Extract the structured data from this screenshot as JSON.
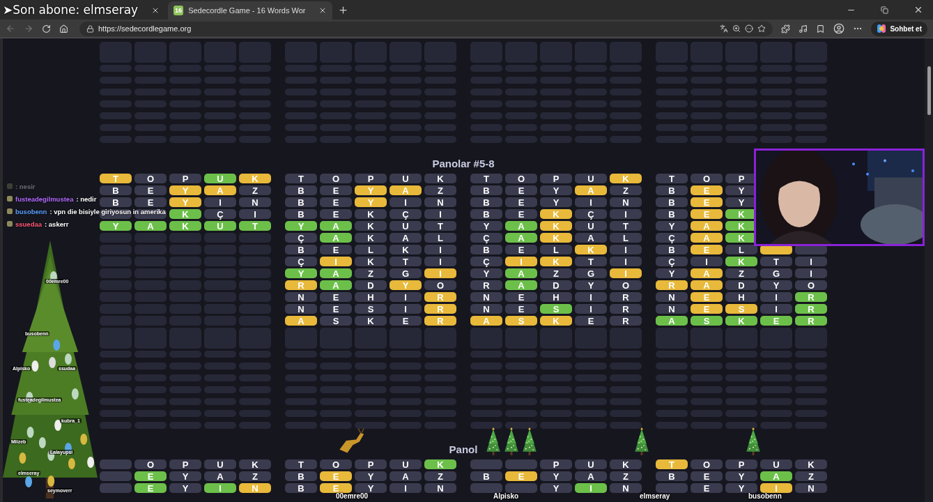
{
  "banner": "➤Son abone: elmseray",
  "tabs": [
    {
      "selected": false
    },
    {
      "icon": "16",
      "title": "Sedecordle Game - 16 Words Wor",
      "selected": true
    }
  ],
  "address": "https://sedecordlegame.org",
  "chat_button": "Sohbet et",
  "sections": [
    {
      "kind": "tail"
    },
    {
      "kind": "full",
      "heading": "Panolar #5-8",
      "boards": [
        {
          "rows": [
            {
              "tiles": [
                {
                  "letter": "T",
                  "color": "#e8b93a"
                },
                {
                  "letter": "O",
                  "color": "#3a3b4e"
                },
                {
                  "letter": "P",
                  "color": "#3a3b4e"
                },
                {
                  "letter": "U",
                  "color": "#6cc04a"
                },
                {
                  "letter": "K",
                  "color": "#e8b93a"
                }
              ]
            },
            {
              "tiles": [
                {
                  "letter": "B",
                  "color": "#3a3b4e"
                },
                {
                  "letter": "E",
                  "color": "#3a3b4e"
                },
                {
                  "letter": "Y",
                  "color": "#e8b93a"
                },
                {
                  "letter": "A",
                  "color": "#e8b93a"
                },
                {
                  "letter": "Z",
                  "color": "#3a3b4e"
                }
              ]
            },
            {
              "tiles": [
                {
                  "letter": "B",
                  "color": "#3a3b4e"
                },
                {
                  "letter": "E",
                  "color": "#3a3b4e"
                },
                {
                  "letter": "Y",
                  "color": "#e8b93a"
                },
                {
                  "letter": "I",
                  "color": "#3a3b4e"
                },
                {
                  "letter": "N",
                  "color": "#3a3b4e"
                }
              ]
            },
            {
              "tiles": [
                {
                  "color": "#3a3b4e"
                },
                {
                  "color": "#3a3b4e"
                },
                {
                  "letter": "K",
                  "color": "#6cc04a"
                },
                {
                  "letter": "Ç",
                  "color": "#3a3b4e"
                },
                {
                  "letter": "I",
                  "color": "#3a3b4e"
                }
              ]
            },
            {
              "tiles": [
                {
                  "letter": "Y",
                  "color": "#6cc04a"
                },
                {
                  "letter": "A",
                  "color": "#6cc04a"
                },
                {
                  "letter": "K",
                  "color": "#6cc04a"
                },
                {
                  "letter": "U",
                  "color": "#6cc04a"
                },
                {
                  "letter": "T",
                  "color": "#6cc04a"
                }
              ]
            }
          ]
        },
        {
          "rows": [
            {
              "tiles": [
                {
                  "letter": "T",
                  "color": "#3a3b4e"
                },
                {
                  "letter": "O",
                  "color": "#3a3b4e"
                },
                {
                  "letter": "P",
                  "color": "#3a3b4e"
                },
                {
                  "letter": "U",
                  "color": "#3a3b4e"
                },
                {
                  "letter": "K",
                  "color": "#3a3b4e"
                }
              ]
            },
            {
              "tiles": [
                {
                  "letter": "B",
                  "color": "#3a3b4e"
                },
                {
                  "letter": "E",
                  "color": "#3a3b4e"
                },
                {
                  "letter": "Y",
                  "color": "#e8b93a"
                },
                {
                  "letter": "A",
                  "color": "#e8b93a"
                },
                {
                  "letter": "Z",
                  "color": "#3a3b4e"
                }
              ]
            },
            {
              "tiles": [
                {
                  "letter": "B",
                  "color": "#3a3b4e"
                },
                {
                  "letter": "E",
                  "color": "#3a3b4e"
                },
                {
                  "letter": "Y",
                  "color": "#e8b93a"
                },
                {
                  "letter": "I",
                  "color": "#3a3b4e"
                },
                {
                  "letter": "N",
                  "color": "#3a3b4e"
                }
              ]
            },
            {
              "tiles": [
                {
                  "letter": "B",
                  "color": "#3a3b4e"
                },
                {
                  "letter": "E",
                  "color": "#3a3b4e"
                },
                {
                  "letter": "K",
                  "color": "#3a3b4e"
                },
                {
                  "letter": "Ç",
                  "color": "#3a3b4e"
                },
                {
                  "letter": "I",
                  "color": "#3a3b4e"
                }
              ]
            },
            {
              "tiles": [
                {
                  "letter": "Y",
                  "color": "#6cc04a"
                },
                {
                  "letter": "A",
                  "color": "#6cc04a"
                },
                {
                  "letter": "K",
                  "color": "#3a3b4e"
                },
                {
                  "letter": "U",
                  "color": "#3a3b4e"
                },
                {
                  "letter": "T",
                  "color": "#3a3b4e"
                }
              ]
            },
            {
              "tiles": [
                {
                  "letter": "Ç",
                  "color": "#3a3b4e"
                },
                {
                  "letter": "A",
                  "color": "#6cc04a"
                },
                {
                  "letter": "K",
                  "color": "#3a3b4e"
                },
                {
                  "letter": "A",
                  "color": "#3a3b4e"
                },
                {
                  "letter": "L",
                  "color": "#3a3b4e"
                }
              ]
            },
            {
              "tiles": [
                {
                  "letter": "B",
                  "color": "#3a3b4e"
                },
                {
                  "letter": "E",
                  "color": "#3a3b4e"
                },
                {
                  "letter": "L",
                  "color": "#3a3b4e"
                },
                {
                  "letter": "K",
                  "color": "#3a3b4e"
                },
                {
                  "letter": "I",
                  "color": "#3a3b4e"
                }
              ]
            },
            {
              "tiles": [
                {
                  "letter": "Ç",
                  "color": "#3a3b4e"
                },
                {
                  "letter": "I",
                  "color": "#e8b93a"
                },
                {
                  "letter": "K",
                  "color": "#3a3b4e"
                },
                {
                  "letter": "T",
                  "color": "#3a3b4e"
                },
                {
                  "letter": "I",
                  "color": "#3a3b4e"
                }
              ]
            },
            {
              "tiles": [
                {
                  "letter": "Y",
                  "color": "#6cc04a"
                },
                {
                  "letter": "A",
                  "color": "#6cc04a"
                },
                {
                  "letter": "Z",
                  "color": "#3a3b4e"
                },
                {
                  "letter": "G",
                  "color": "#3a3b4e"
                },
                {
                  "letter": "I",
                  "color": "#e8b93a"
                }
              ]
            },
            {
              "tiles": [
                {
                  "letter": "R",
                  "color": "#e8b93a"
                },
                {
                  "letter": "A",
                  "color": "#6cc04a"
                },
                {
                  "letter": "D",
                  "color": "#3a3b4e"
                },
                {
                  "letter": "Y",
                  "color": "#e8b93a"
                },
                {
                  "letter": "O",
                  "color": "#3a3b4e"
                }
              ]
            },
            {
              "tiles": [
                {
                  "letter": "N",
                  "color": "#3a3b4e"
                },
                {
                  "letter": "E",
                  "color": "#3a3b4e"
                },
                {
                  "letter": "H",
                  "color": "#3a3b4e"
                },
                {
                  "letter": "I",
                  "color": "#3a3b4e"
                },
                {
                  "letter": "R",
                  "color": "#e8b93a"
                }
              ]
            },
            {
              "tiles": [
                {
                  "letter": "N",
                  "color": "#3a3b4e"
                },
                {
                  "letter": "E",
                  "color": "#3a3b4e"
                },
                {
                  "letter": "S",
                  "color": "#3a3b4e"
                },
                {
                  "letter": "I",
                  "color": "#3a3b4e"
                },
                {
                  "letter": "R",
                  "color": "#e8b93a"
                }
              ]
            },
            {
              "tiles": [
                {
                  "letter": "A",
                  "color": "#e8b93a"
                },
                {
                  "letter": "S",
                  "color": "#3a3b4e"
                },
                {
                  "letter": "K",
                  "color": "#3a3b4e"
                },
                {
                  "letter": "E",
                  "color": "#3a3b4e"
                },
                {
                  "letter": "R",
                  "color": "#e8b93a"
                }
              ]
            }
          ]
        },
        {
          "rows": [
            {
              "tiles": [
                {
                  "letter": "T",
                  "color": "#3a3b4e"
                },
                {
                  "letter": "O",
                  "color": "#3a3b4e"
                },
                {
                  "letter": "P",
                  "color": "#3a3b4e"
                },
                {
                  "letter": "U",
                  "color": "#3a3b4e"
                },
                {
                  "letter": "K",
                  "color": "#e8b93a"
                }
              ]
            },
            {
              "tiles": [
                {
                  "letter": "B",
                  "color": "#3a3b4e"
                },
                {
                  "letter": "E",
                  "color": "#3a3b4e"
                },
                {
                  "letter": "Y",
                  "color": "#3a3b4e"
                },
                {
                  "letter": "A",
                  "color": "#e8b93a"
                },
                {
                  "letter": "Z",
                  "color": "#3a3b4e"
                }
              ]
            },
            {
              "tiles": [
                {
                  "letter": "B",
                  "color": "#3a3b4e"
                },
                {
                  "letter": "E",
                  "color": "#3a3b4e"
                },
                {
                  "letter": "Y",
                  "color": "#3a3b4e"
                },
                {
                  "letter": "I",
                  "color": "#3a3b4e"
                },
                {
                  "letter": "N",
                  "color": "#3a3b4e"
                }
              ]
            },
            {
              "tiles": [
                {
                  "letter": "B",
                  "color": "#3a3b4e"
                },
                {
                  "letter": "E",
                  "color": "#3a3b4e"
                },
                {
                  "letter": "K",
                  "color": "#e8b93a"
                },
                {
                  "letter": "Ç",
                  "color": "#3a3b4e"
                },
                {
                  "letter": "I",
                  "color": "#3a3b4e"
                }
              ]
            },
            {
              "tiles": [
                {
                  "letter": "Y",
                  "color": "#3a3b4e"
                },
                {
                  "letter": "A",
                  "color": "#6cc04a"
                },
                {
                  "letter": "K",
                  "color": "#e8b93a"
                },
                {
                  "letter": "U",
                  "color": "#3a3b4e"
                },
                {
                  "letter": "T",
                  "color": "#3a3b4e"
                }
              ]
            },
            {
              "tiles": [
                {
                  "letter": "Ç",
                  "color": "#3a3b4e"
                },
                {
                  "letter": "A",
                  "color": "#6cc04a"
                },
                {
                  "letter": "K",
                  "color": "#e8b93a"
                },
                {
                  "letter": "A",
                  "color": "#3a3b4e"
                },
                {
                  "letter": "L",
                  "color": "#3a3b4e"
                }
              ]
            },
            {
              "tiles": [
                {
                  "letter": "B",
                  "color": "#3a3b4e"
                },
                {
                  "letter": "E",
                  "color": "#3a3b4e"
                },
                {
                  "letter": "L",
                  "color": "#3a3b4e"
                },
                {
                  "letter": "K",
                  "color": "#e8b93a"
                },
                {
                  "letter": "I",
                  "color": "#3a3b4e"
                }
              ]
            },
            {
              "tiles": [
                {
                  "letter": "Ç",
                  "color": "#3a3b4e"
                },
                {
                  "letter": "I",
                  "color": "#e8b93a"
                },
                {
                  "letter": "K",
                  "color": "#e8b93a"
                },
                {
                  "letter": "T",
                  "color": "#3a3b4e"
                },
                {
                  "letter": "I",
                  "color": "#3a3b4e"
                }
              ]
            },
            {
              "tiles": [
                {
                  "letter": "Y",
                  "color": "#3a3b4e"
                },
                {
                  "letter": "A",
                  "color": "#6cc04a"
                },
                {
                  "letter": "Z",
                  "color": "#3a3b4e"
                },
                {
                  "letter": "G",
                  "color": "#3a3b4e"
                },
                {
                  "letter": "I",
                  "color": "#e8b93a"
                }
              ]
            },
            {
              "tiles": [
                {
                  "letter": "R",
                  "color": "#3a3b4e"
                },
                {
                  "letter": "A",
                  "color": "#6cc04a"
                },
                {
                  "letter": "D",
                  "color": "#3a3b4e"
                },
                {
                  "letter": "Y",
                  "color": "#3a3b4e"
                },
                {
                  "letter": "O",
                  "color": "#3a3b4e"
                }
              ]
            },
            {
              "tiles": [
                {
                  "letter": "N",
                  "color": "#3a3b4e"
                },
                {
                  "letter": "E",
                  "color": "#3a3b4e"
                },
                {
                  "letter": "H",
                  "color": "#3a3b4e"
                },
                {
                  "letter": "I",
                  "color": "#3a3b4e"
                },
                {
                  "letter": "R",
                  "color": "#3a3b4e"
                }
              ]
            },
            {
              "tiles": [
                {
                  "letter": "N",
                  "color": "#3a3b4e"
                },
                {
                  "letter": "E",
                  "color": "#3a3b4e"
                },
                {
                  "letter": "S",
                  "color": "#6cc04a"
                },
                {
                  "letter": "I",
                  "color": "#3a3b4e"
                },
                {
                  "letter": "R",
                  "color": "#3a3b4e"
                }
              ]
            },
            {
              "tiles": [
                {
                  "letter": "A",
                  "color": "#e8b93a"
                },
                {
                  "letter": "S",
                  "color": "#e8b93a"
                },
                {
                  "letter": "K",
                  "color": "#e8b93a"
                },
                {
                  "letter": "E",
                  "color": "#3a3b4e"
                },
                {
                  "letter": "R",
                  "color": "#3a3b4e"
                }
              ]
            }
          ]
        },
        {
          "rows": [
            {
              "tiles": [
                {
                  "letter": "T",
                  "color": "#3a3b4e"
                },
                {
                  "letter": "O",
                  "color": "#3a3b4e"
                },
                {
                  "letter": "P",
                  "color": "#3a3b4e"
                }
              ]
            },
            {
              "tiles": [
                {
                  "letter": "B",
                  "color": "#3a3b4e"
                },
                {
                  "letter": "E",
                  "color": "#e8b93a"
                },
                {
                  "letter": "Y",
                  "color": "#3a3b4e"
                }
              ]
            },
            {
              "tiles": [
                {
                  "letter": "B",
                  "color": "#3a3b4e"
                },
                {
                  "letter": "E",
                  "color": "#e8b93a"
                },
                {
                  "letter": "Y",
                  "color": "#3a3b4e"
                }
              ]
            },
            {
              "tiles": [
                {
                  "letter": "B",
                  "color": "#3a3b4e"
                },
                {
                  "letter": "E",
                  "color": "#e8b93a"
                },
                {
                  "letter": "K",
                  "color": "#6cc04a"
                }
              ]
            },
            {
              "tiles": [
                {
                  "letter": "Y",
                  "color": "#3a3b4e"
                },
                {
                  "letter": "A",
                  "color": "#e8b93a"
                },
                {
                  "letter": "K",
                  "color": "#6cc04a"
                }
              ]
            },
            {
              "tiles": [
                {
                  "letter": "Ç",
                  "color": "#3a3b4e"
                },
                {
                  "letter": "A",
                  "color": "#e8b93a"
                },
                {
                  "letter": "K",
                  "color": "#6cc04a"
                }
              ]
            },
            {
              "tiles": [
                {
                  "letter": "B",
                  "color": "#3a3b4e"
                },
                {
                  "letter": "E",
                  "color": "#e8b93a"
                },
                {
                  "letter": "L",
                  "color": "#3a3b4e"
                },
                {
                  "color": "#e8b93a"
                },
                {
                  "color": "#3a3b4e"
                }
              ]
            },
            {
              "tiles": [
                {
                  "letter": "Ç",
                  "color": "#3a3b4e"
                },
                {
                  "letter": "I",
                  "color": "#3a3b4e"
                },
                {
                  "letter": "K",
                  "color": "#6cc04a"
                },
                {
                  "letter": "T",
                  "color": "#3a3b4e"
                },
                {
                  "letter": "I",
                  "color": "#3a3b4e"
                }
              ]
            },
            {
              "tiles": [
                {
                  "letter": "Y",
                  "color": "#3a3b4e"
                },
                {
                  "letter": "A",
                  "color": "#e8b93a"
                },
                {
                  "letter": "Z",
                  "color": "#3a3b4e"
                },
                {
                  "letter": "G",
                  "color": "#3a3b4e"
                },
                {
                  "letter": "I",
                  "color": "#3a3b4e"
                }
              ]
            },
            {
              "tiles": [
                {
                  "letter": "R",
                  "color": "#e8b93a"
                },
                {
                  "letter": "A",
                  "color": "#e8b93a"
                },
                {
                  "letter": "D",
                  "color": "#3a3b4e"
                },
                {
                  "letter": "Y",
                  "color": "#3a3b4e"
                },
                {
                  "letter": "O",
                  "color": "#3a3b4e"
                }
              ]
            },
            {
              "tiles": [
                {
                  "letter": "N",
                  "color": "#3a3b4e"
                },
                {
                  "letter": "E",
                  "color": "#e8b93a"
                },
                {
                  "letter": "H",
                  "color": "#3a3b4e"
                },
                {
                  "letter": "I",
                  "color": "#3a3b4e"
                },
                {
                  "letter": "R",
                  "color": "#6cc04a"
                }
              ]
            },
            {
              "tiles": [
                {
                  "letter": "N",
                  "color": "#3a3b4e"
                },
                {
                  "letter": "E",
                  "color": "#e8b93a"
                },
                {
                  "letter": "S",
                  "color": "#e8b93a"
                },
                {
                  "letter": "I",
                  "color": "#3a3b4e"
                },
                {
                  "letter": "R",
                  "color": "#6cc04a"
                }
              ]
            },
            {
              "tiles": [
                {
                  "letter": "A",
                  "color": "#6cc04a"
                },
                {
                  "letter": "S",
                  "color": "#6cc04a"
                },
                {
                  "letter": "K",
                  "color": "#6cc04a"
                },
                {
                  "letter": "E",
                  "color": "#6cc04a"
                },
                {
                  "letter": "R",
                  "color": "#6cc04a"
                }
              ]
            }
          ]
        }
      ]
    },
    {
      "kind": "head",
      "heading": "Panol",
      "boards": [
        {
          "rows": [
            {
              "tiles": [
                {
                  "color": "#3a3b4e"
                },
                {
                  "letter": "O",
                  "color": "#3a3b4e"
                },
                {
                  "letter": "P",
                  "color": "#3a3b4e"
                },
                {
                  "letter": "U",
                  "color": "#3a3b4e"
                },
                {
                  "letter": "K",
                  "color": "#3a3b4e"
                }
              ]
            },
            {
              "tiles": [
                {
                  "color": "#3a3b4e"
                },
                {
                  "letter": "E",
                  "color": "#6cc04a"
                },
                {
                  "letter": "Y",
                  "color": "#3a3b4e"
                },
                {
                  "letter": "A",
                  "color": "#3a3b4e"
                },
                {
                  "letter": "Z",
                  "color": "#3a3b4e"
                }
              ]
            },
            {
              "tiles": [
                {
                  "color": "#3a3b4e"
                },
                {
                  "letter": "E",
                  "color": "#6cc04a"
                },
                {
                  "letter": "Y",
                  "color": "#3a3b4e"
                },
                {
                  "letter": "I",
                  "color": "#6cc04a"
                },
                {
                  "letter": "N",
                  "color": "#e8b93a"
                }
              ]
            }
          ]
        },
        {
          "rows": [
            {
              "tiles": [
                {
                  "letter": "T",
                  "color": "#3a3b4e"
                },
                {
                  "letter": "O",
                  "color": "#3a3b4e"
                },
                {
                  "letter": "P",
                  "color": "#3a3b4e"
                },
                {
                  "letter": "U",
                  "color": "#3a3b4e"
                },
                {
                  "letter": "K",
                  "color": "#6cc04a"
                }
              ]
            },
            {
              "tiles": [
                {
                  "letter": "B",
                  "color": "#3a3b4e"
                },
                {
                  "letter": "E",
                  "color": "#e8b93a"
                },
                {
                  "letter": "Y",
                  "color": "#3a3b4e"
                },
                {
                  "letter": "A",
                  "color": "#3a3b4e"
                },
                {
                  "letter": "Z",
                  "color": "#3a3b4e"
                }
              ]
            },
            {
              "tiles": [
                {
                  "letter": "B",
                  "color": "#3a3b4e"
                },
                {
                  "letter": "E",
                  "color": "#e8b93a"
                },
                {
                  "letter": "Y",
                  "color": "#3a3b4e"
                },
                {
                  "letter": "I",
                  "color": "#3a3b4e"
                },
                {
                  "letter": "N",
                  "color": "#3a3b4e"
                }
              ]
            }
          ]
        },
        {
          "rows": [
            {
              "tiles": [
                {
                  "color": "#3a3b4e"
                },
                {
                  "color": "#3a3b4e"
                },
                {
                  "letter": "P",
                  "color": "#3a3b4e"
                },
                {
                  "letter": "U",
                  "color": "#3a3b4e"
                },
                {
                  "letter": "K",
                  "color": "#3a3b4e"
                }
              ]
            },
            {
              "tiles": [
                {
                  "letter": "B",
                  "color": "#3a3b4e"
                },
                {
                  "letter": "E",
                  "color": "#e8b93a"
                },
                {
                  "letter": "Y",
                  "color": "#3a3b4e"
                },
                {
                  "letter": "A",
                  "color": "#3a3b4e"
                },
                {
                  "letter": "Z",
                  "color": "#3a3b4e"
                }
              ]
            },
            {
              "tiles": [
                {
                  "color": "#3a3b4e"
                },
                {
                  "color": "#3a3b4e"
                },
                {
                  "letter": "Y",
                  "color": "#3a3b4e"
                },
                {
                  "letter": "I",
                  "color": "#6cc04a"
                },
                {
                  "letter": "N",
                  "color": "#3a3b4e"
                }
              ]
            }
          ]
        },
        {
          "rows": [
            {
              "tiles": [
                {
                  "letter": "T",
                  "color": "#e8b93a"
                },
                {
                  "letter": "O",
                  "color": "#3a3b4e"
                },
                {
                  "letter": "P",
                  "color": "#3a3b4e"
                },
                {
                  "letter": "U",
                  "color": "#3a3b4e"
                },
                {
                  "letter": "K",
                  "color": "#3a3b4e"
                }
              ]
            },
            {
              "tiles": [
                {
                  "letter": "B",
                  "color": "#3a3b4e"
                },
                {
                  "letter": "E",
                  "color": "#3a3b4e"
                },
                {
                  "letter": "Y",
                  "color": "#3a3b4e"
                },
                {
                  "letter": "A",
                  "color": "#6cc04a"
                },
                {
                  "letter": "Z",
                  "color": "#3a3b4e"
                }
              ]
            },
            {
              "tiles": [
                {
                  "color": "#3a3b4e"
                },
                {
                  "letter": "E",
                  "color": "#3a3b4e"
                },
                {
                  "letter": "Y",
                  "color": "#3a3b4e"
                },
                {
                  "letter": "I",
                  "color": "#e8b93a"
                },
                {
                  "letter": "N",
                  "color": "#3a3b4e"
                }
              ]
            }
          ]
        }
      ]
    }
  ],
  "chat": [
    {
      "text": ": nesir",
      "faded": true
    },
    {
      "name": "fusteadegilmustea",
      "color": "#b36bff",
      "text": ": nedir",
      "faded": false
    },
    {
      "name": "busobenn",
      "color": "#5aa0ff",
      "text": ": vpn die bisiyle giriyosun in amerika",
      "faded": false
    },
    {
      "name": "ssuedaa",
      "color": "#ff5a78",
      "text": ": askerr",
      "faded": false
    }
  ],
  "tree_labels": [
    "00emre00",
    "busobenn",
    "Alpisko",
    "ssudaa",
    "fusteadegilmustea",
    "kubra_1",
    "Miizeb",
    "Lalayupsi",
    "elmseray",
    "seymoverr"
  ],
  "stream_labels": [
    "00emre00",
    "Alpisko",
    "elmseray",
    "busobenn"
  ]
}
